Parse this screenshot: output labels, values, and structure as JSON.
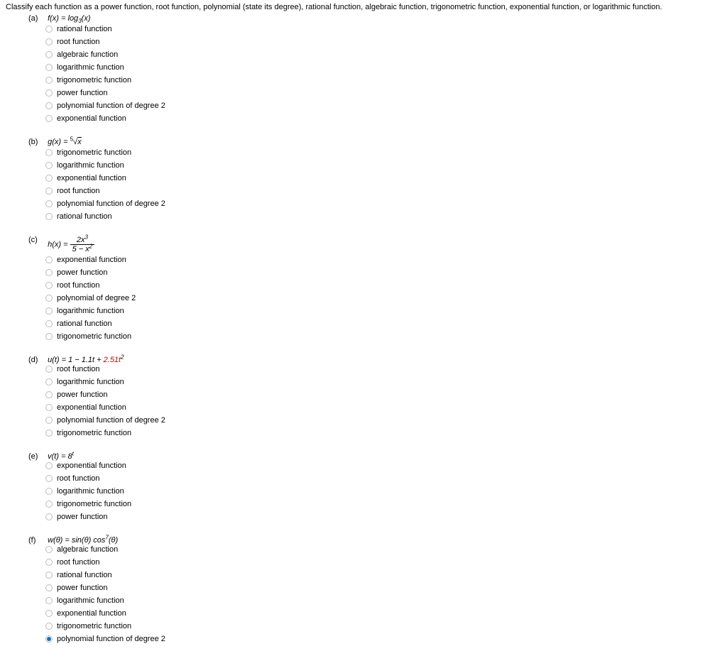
{
  "instructions": "Classify each function as a power function, root function, polynomial (state its degree), rational function, algebraic function, trigonometric function, exponential function, or logarithmic function.",
  "questions": {
    "a": {
      "label": "(a)",
      "formula_html": "<i>f</i>(<i>x</i>) = log<sub>3</sub>(<i>x</i>)",
      "options": [
        "rational function",
        "root function",
        "algebraic function",
        "logarithmic function",
        "trigonometric function",
        "power function",
        "polynomial function of degree 2",
        "exponential function"
      ],
      "selected": -1
    },
    "b": {
      "label": "(b)",
      "formula_html": "<i>g</i>(<i>x</i>) = <span class='root-sym'><sup style='font-size:8px;'>5</sup>√</span><span style='border-top:1px solid #000;padding-top:0;'><i>x</i></span>",
      "options": [
        "trigonometric function",
        "logarithmic function",
        "exponential function",
        "root function",
        "polynomial function of degree 2",
        "rational function"
      ],
      "selected": -1
    },
    "c": {
      "label": "(c)",
      "formula_html": "<i>h</i>(<i>x</i>) = <span class='frac'><span class='num'>2<i>x</i><sup>3</sup></span><span class='den'>5 − <i>x</i><sup>2</sup></span></span>",
      "options": [
        "exponential function",
        "power function",
        "root function",
        "polynomial of degree 2",
        "logarithmic function",
        "rational function",
        "trigonometric function"
      ],
      "selected": -1
    },
    "d": {
      "label": "(d)",
      "formula_plain_prefix": "u(t) = 1 − 1.1t + ",
      "formula_red": "2.51t",
      "formula_sup": "2",
      "options": [
        "root function",
        "logarithmic function",
        "power function",
        "exponential function",
        "polynomial function of degree 2",
        "trigonometric function"
      ],
      "selected": -1
    },
    "e": {
      "label": "(e)",
      "formula_html": "<i>v</i>(<i>t</i>) = 8<sup><i>t</i></sup>",
      "options": [
        "exponential function",
        "root function",
        "logarithmic function",
        "trigonometric function",
        "power function"
      ],
      "selected": -1
    },
    "f": {
      "label": "(f)",
      "formula_html": "<i>w</i>(<i>θ</i>) = sin(<i>θ</i>) cos<sup>7</sup>(<i>θ</i>)",
      "options": [
        "algebraic function",
        "root function",
        "rational function",
        "power function",
        "logarithmic function",
        "exponential function",
        "trigonometric function",
        "polynomial function of degree 2"
      ],
      "selected": 7
    }
  }
}
